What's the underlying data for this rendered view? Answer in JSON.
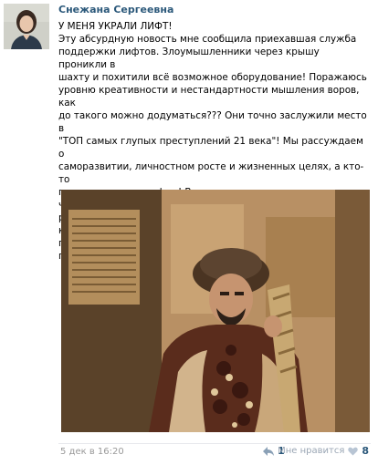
{
  "post": {
    "author": "Снежана Сергеевна",
    "text": "У МЕНЯ УКРАЛИ ЛИФТ!\nЭту абсурдную новость мне сообщила приехавшая служба\nподдержки лифтов. Злоумышленники через крышу проникли в\nшахту и похитили всё возможное оборудование! Поражаюсь\nуровню креативности и нестандартности мышления воров, как\nдо такого можно додуматься??? Они точно заслужили место в\n\"ТОП самых глупых преступлений 21 века\"! Мы рассуждаем о\nсаморазвитии, личностном росте и жизненных целях, а кто-то\nпросто... воруют лифты! Вот так контрастность человеческого\nразвития! Поэтому развивайте своё мышление, расширяйте\nкругозор, посещайте тренинги и семинары, чтобы в одно\nпрекрасное утро вашу светлую голову не озарила мысль \"А\nпочему бы мне не заняться хищением лифтов?\"",
    "date": "5 дек в 16:20",
    "reply_count": "1",
    "like_label": "Мне нравится",
    "like_count": "8"
  },
  "colors": {
    "author_link": "#2b587a",
    "meta_text": "#999999",
    "divider": "#e7e8ec"
  },
  "icons": {
    "reply": "reply-arrow-icon",
    "like": "heart-icon"
  }
}
